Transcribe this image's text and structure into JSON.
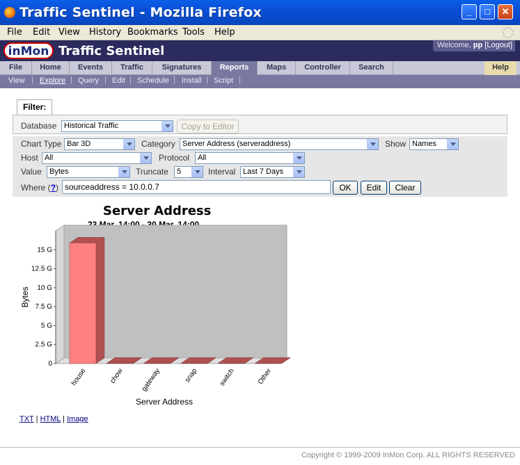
{
  "window": {
    "title": "Traffic Sentinel - Mozilla Firefox",
    "minimize": "_",
    "maximize": "□",
    "close": "✕"
  },
  "menu": [
    "File",
    "Edit",
    "View",
    "History",
    "Bookmarks",
    "Tools",
    "Help"
  ],
  "header": {
    "logo_text": "inMon",
    "app_title": "Traffic Sentinel",
    "welcome_prefix": "Welcome,",
    "user": "pp",
    "logout": "[Logout]"
  },
  "nav": {
    "tabs": [
      "File",
      "Home",
      "Events",
      "Traffic",
      "Signatures",
      "Reports",
      "Maps",
      "Controller",
      "Search"
    ],
    "active": "Reports",
    "help": "Help"
  },
  "subnav": {
    "items": [
      "View",
      "Explore",
      "Query",
      "Edit",
      "Schedule",
      "Install",
      "Script"
    ],
    "active": "Explore"
  },
  "filter": {
    "legend": "Filter:",
    "database_label": "Database",
    "database_value": "Historical Traffic",
    "copy_to_editor": "Copy to Editor",
    "chart_type_label": "Chart Type",
    "chart_type_value": "Bar 3D",
    "category_label": "Category",
    "category_value": "Server Address (serveraddress)",
    "show_label": "Show",
    "show_value": "Names",
    "host_label": "Host",
    "host_value": "All",
    "protocol_label": "Protocol",
    "protocol_value": "All",
    "value_label": "Value",
    "value_value": "Bytes",
    "truncate_label": "Truncate",
    "truncate_value": "5",
    "interval_label": "Interval",
    "interval_value": "Last 7 Days",
    "where_label": "Where",
    "where_help": "?",
    "where_value": "sourceaddress = 10.0.0.7",
    "ok": "OK",
    "edit": "Edit",
    "clear": "Clear"
  },
  "chart_data": {
    "type": "bar",
    "title": "Server Address",
    "subtitle": "23 Mar, 14:00 -  30 Mar, 14:00",
    "xlabel": "Server Address",
    "ylabel": "Bytes",
    "categories": [
      "house",
      "chow",
      "gateway",
      "snap",
      "switch",
      "Other"
    ],
    "values": [
      15.9,
      0.05,
      0.05,
      0.05,
      0.05,
      0.05
    ],
    "value_unit": "G",
    "ylim": [
      0,
      17.5
    ],
    "yticks": [
      0,
      2.5,
      5,
      7.5,
      10,
      12.5,
      15
    ],
    "ytick_labels": [
      "0",
      "2.5 G",
      "5 G",
      "7.5 G",
      "10 G",
      "12.5 G",
      "15 G"
    ],
    "grid": false,
    "bar_color": "#ff8080",
    "bar_side_color": "#b05050",
    "plot_background": "#c0c0c0"
  },
  "export_links": [
    "TXT",
    "HTML",
    "Image"
  ],
  "export_sep": "|",
  "footer": "Copyright © 1999-2009 InMon Corp. ALL RIGHTS RESERVED"
}
